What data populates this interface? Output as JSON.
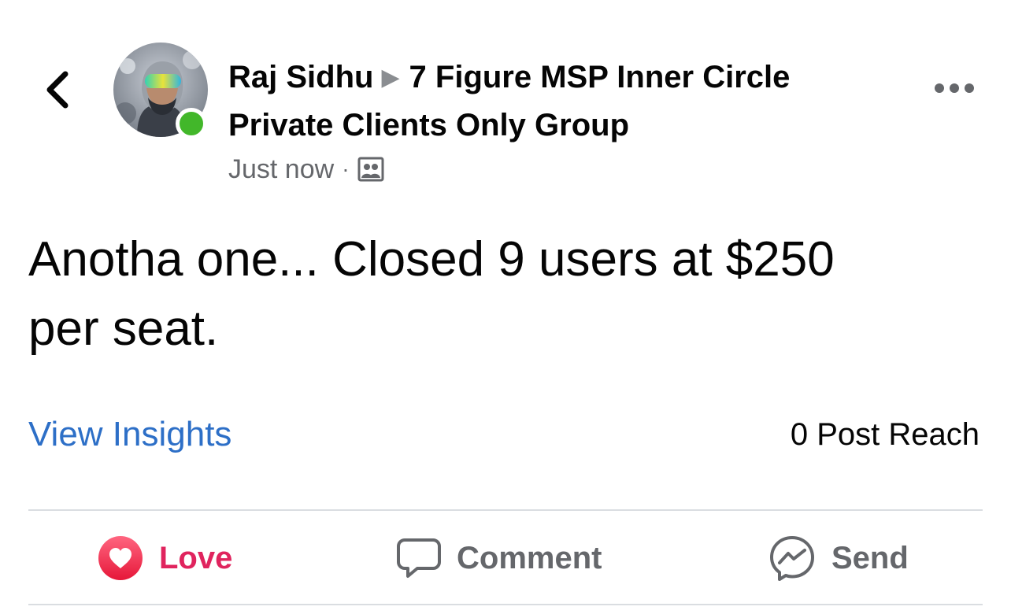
{
  "header": {
    "author": "Raj Sidhu",
    "group_line1": "7 Figure MSP Inner Circle",
    "group_line2": "Private Clients Only Group",
    "timestamp": "Just now",
    "separator": "·",
    "audience_icon": "group-audience-icon",
    "online": true
  },
  "post": {
    "text_line1": "Anotha one... Closed 9 users at $250",
    "text_line2": "per seat."
  },
  "insights": {
    "view_label": "View Insights",
    "reach_label": "0 Post Reach"
  },
  "actions": {
    "love_label": "Love",
    "comment_label": "Comment",
    "send_label": "Send"
  },
  "colors": {
    "link": "#2d6fc7",
    "love": "#e0245e",
    "online": "#42b72a",
    "muted": "#65676b"
  }
}
